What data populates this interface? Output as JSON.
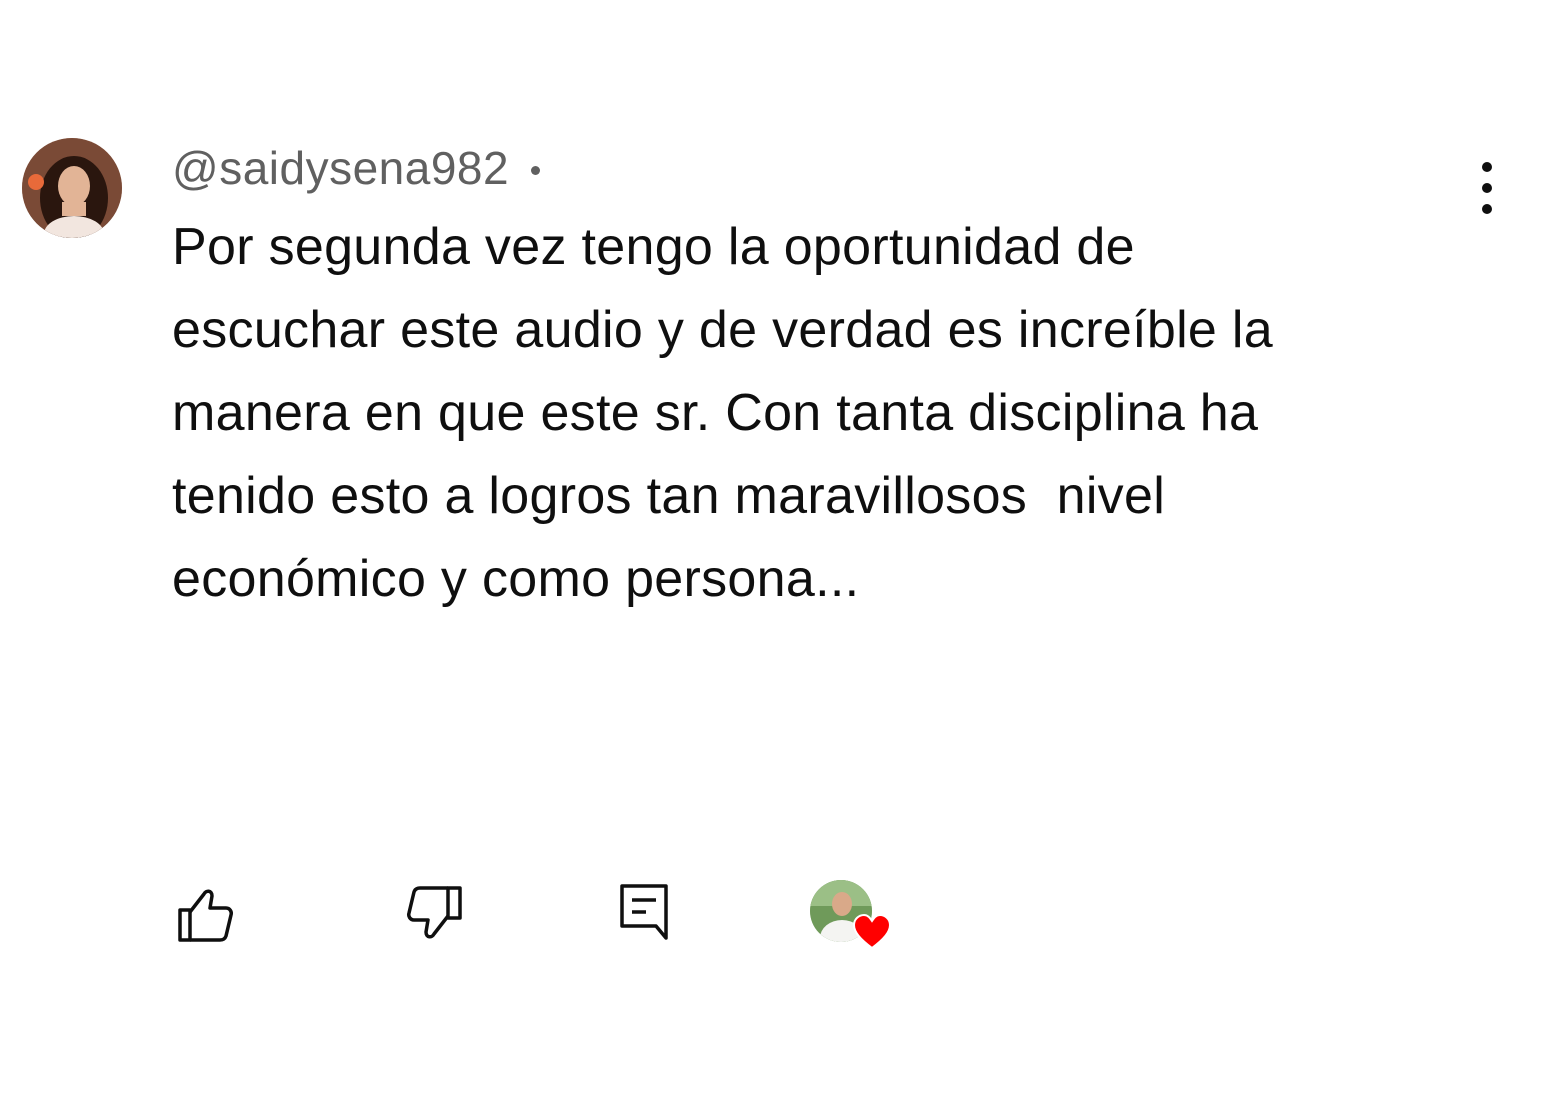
{
  "comment": {
    "author_handle": "@saidysena982",
    "separator": "•",
    "timestamp": "",
    "text": "Por segunda vez tengo la oportunidad de\nescuchar este audio y de verdad es increíble la\nmanera en que este sr. Con tanta disciplina ha\ntenido esto a logros tan maravillosos  nivel\neconómico y como persona...",
    "avatar_icon": "user-avatar-photo",
    "menu_icon": "more-vert-icon"
  },
  "actions": {
    "like_icon": "thumb-up-icon",
    "dislike_icon": "thumb-down-icon",
    "reply_icon": "comment-reply-icon",
    "creator_heart_icon": "creator-heart-badge"
  },
  "colors": {
    "text_primary": "#0f0f0f",
    "text_secondary": "#606060",
    "heart": "#ff0000",
    "background": "#ffffff"
  }
}
